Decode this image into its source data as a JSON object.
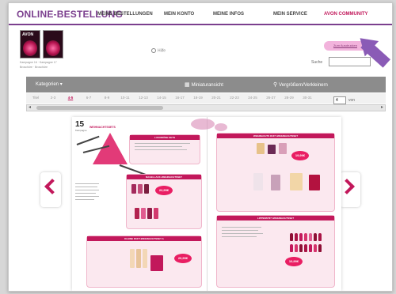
{
  "topnav": {
    "brand": "ONLINE-BESTELLUNG",
    "items": [
      "MEINE BESTELLUNGEN",
      "MEIN KONTO",
      "MEINE INFOS",
      "MEIN SERVICE",
      "AVON COMMUNITY"
    ]
  },
  "brochures": {
    "logo": "AVON",
    "captions": [
      "Kampagne 16 · Kampagne 17",
      "Broschüre · Broschüre"
    ]
  },
  "header": {
    "info_label": "Hilfe",
    "search_label": "Suche",
    "search_value": "",
    "print_label": "Zum Ausdrucken"
  },
  "toolbar": {
    "categories": "Kategorien",
    "thumbnail_view": "Miniaturansicht",
    "zoom": "Vergrößern/Verkleinern"
  },
  "pages": {
    "labels": [
      "Titel",
      "2-3",
      "4-5",
      "6-7",
      "8-9",
      "10-11",
      "12-13",
      "14-15",
      "16-17",
      "18-19",
      "20-21",
      "22-23",
      "24-25",
      "26-27",
      "28-29",
      "30-31"
    ],
    "active": "4-5",
    "current_input": "4",
    "total_label": "von"
  },
  "spread": {
    "page_number": "15",
    "page_sub": "Kampagne",
    "headline": "WEIHNACHTSSETS",
    "price_1": "22,99€",
    "price_2": "20,99€",
    "price_3": "19,99€",
    "price_4": "10,99€",
    "panel_titles": [
      "LUXURIÖSE SETS",
      "NAGELLACK-WEIHNACHTSSET",
      "KLEINE DUFT-WEIHNACHTSSET A",
      "WEIHNACHTS DUFT-WEIHNACHTSSET",
      "LIPPENSTIFT-WEIHNACHTSSET"
    ]
  },
  "colors": {
    "brand_purple": "#7b3f8e",
    "accent_pink": "#c2185b",
    "toolbar_gray": "#8c8c8c"
  }
}
